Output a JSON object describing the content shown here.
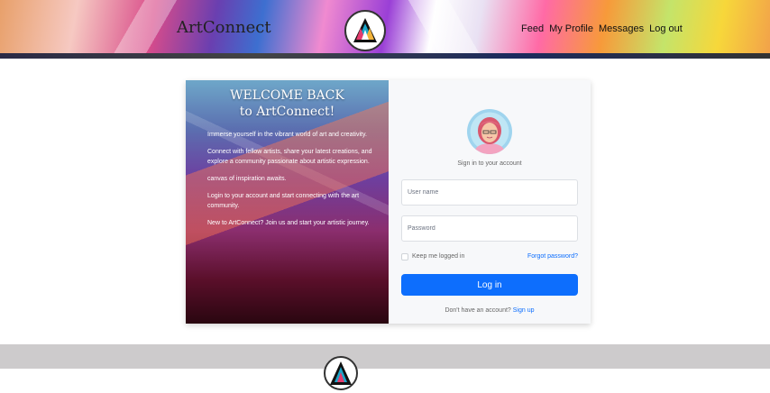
{
  "header": {
    "brand": "ArtConnect",
    "nav": [
      "Feed",
      "My Profile",
      "Messages",
      "Log out"
    ]
  },
  "welcome_panel": {
    "title_line1": "WELCOME BACK",
    "title_line2": "to ArtConnect!",
    "paragraphs": [
      "Immerse yourself in the vibrant world of art and creativity.",
      "Connect with fellow artists, share your latest creations, and explore a community passionate about artistic expression.",
      "canvas of inspiration awaits.",
      "Login to your account and start connecting with the art community.",
      "New to ArtConnect? Join us and start your artistic journey."
    ]
  },
  "login": {
    "subtitle": "Sign in to your account",
    "username_placeholder": "User name",
    "password_placeholder": "Password",
    "keep_logged": "Keep me logged in",
    "forgot": "Forgot password?",
    "button": "Log in",
    "no_account": "Don't have an account?",
    "signup": "Sign up"
  },
  "colors": {
    "primary": "#0d6efd",
    "footer": "#cdcbcc"
  }
}
